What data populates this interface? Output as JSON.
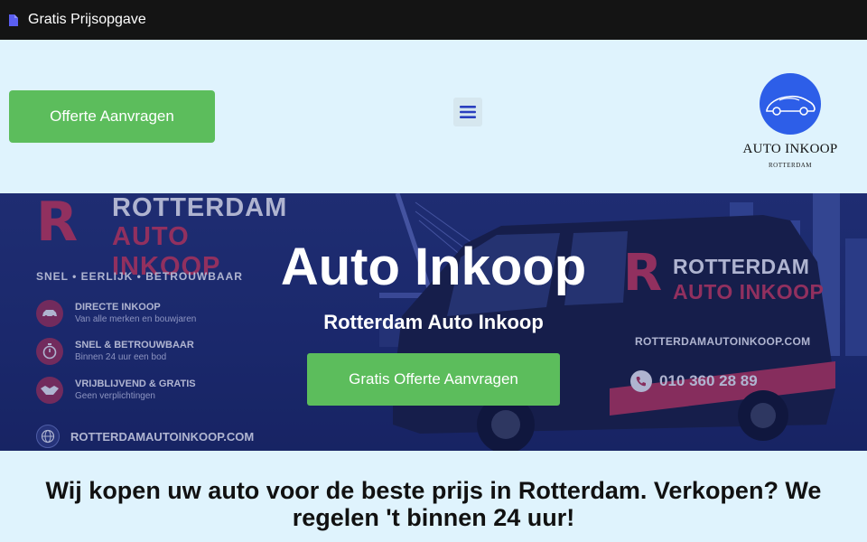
{
  "topbar": {
    "link_label": "Gratis Prijsopgave",
    "icon": "document-icon"
  },
  "header": {
    "cta_label": "Offerte Aanvragen",
    "menu_icon": "hamburger-menu-icon",
    "logo": {
      "title": "AUTO INKOOP",
      "subtitle": "ROTTERDAM"
    }
  },
  "hero": {
    "title": "Auto Inkoop",
    "subtitle": "Rotterdam Auto Inkoop",
    "button_label": "Gratis Offerte Aanvragen",
    "image": {
      "brand_line_1": "ROTTERDAM",
      "brand_line_2": "AUTO INKOOP",
      "brand_letter": "R",
      "slogan": "SNEL • EERLIJK • BETROUWBAAR",
      "features": [
        {
          "title": "DIRECTE INKOOP",
          "subtitle": "Van alle merken en bouwjaren",
          "icon": "car-icon"
        },
        {
          "title": "SNEL & BETROUWBAAR",
          "subtitle": "Binnen 24 uur een bod",
          "icon": "stopwatch-icon"
        },
        {
          "title": "VRIJBLIJVEND & GRATIS",
          "subtitle": "Geen verplichtingen",
          "icon": "handshake-icon"
        }
      ],
      "website": "ROTTERDAMAUTOINKOOP.COM",
      "van_brand_line_1": "ROTTERDAM",
      "van_brand_line_2": "AUTO INKOOP",
      "van_website": "ROTTERDAMAUTOINKOOP.COM",
      "van_phone": "010 360 28 89"
    }
  },
  "intro": {
    "title": "Wij kopen uw auto voor de beste prijs in Rotterdam. Verkopen? We regelen 't binnen 24 uur!"
  },
  "colors": {
    "topbar_bg": "#141414",
    "page_bg": "#dff3fd",
    "cta_green": "#5cbd5c",
    "hero_navy": "#1c2966",
    "brand_red": "#d23552",
    "logo_blue": "#2d5ee8"
  }
}
